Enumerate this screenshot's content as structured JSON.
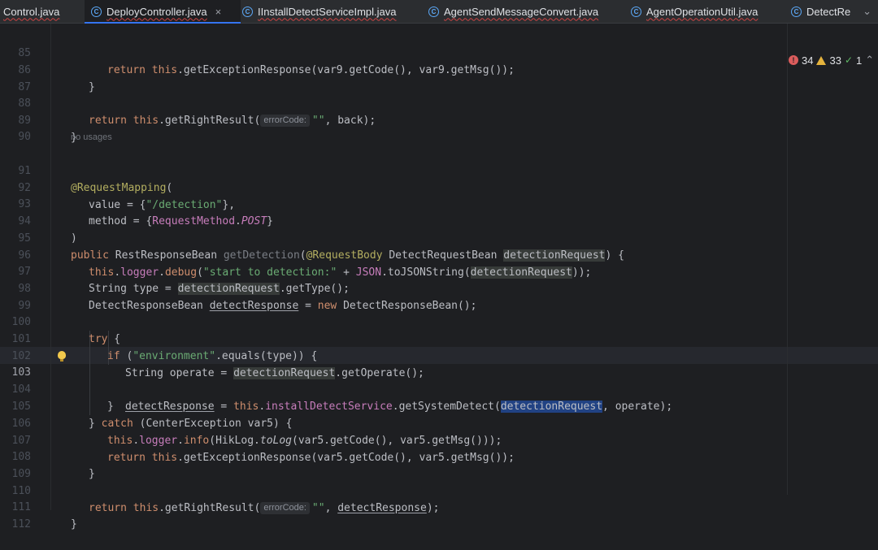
{
  "tabs": [
    {
      "label": "Control.java",
      "icon": "class-icon-clipped",
      "active": false
    },
    {
      "label": "DeployController.java",
      "icon": "class-icon",
      "active": true
    },
    {
      "label": "IInstallDetectServiceImpl.java",
      "icon": "class-icon",
      "active": false
    },
    {
      "label": "AgentSendMessageConvert.java",
      "icon": "class-icon",
      "active": false
    },
    {
      "label": "AgentOperationUtil.java",
      "icon": "class-icon",
      "active": false
    },
    {
      "label": "DetectRe",
      "icon": "class-icon",
      "active": false
    }
  ],
  "tab_close_glyph": "×",
  "tab_more_glyph": "⌄",
  "inspections": {
    "errors": "34",
    "warnings": "33",
    "ok": "1",
    "error_glyph": "!",
    "ok_glyph": "✓",
    "more_glyph": "⌃"
  },
  "no_usages_note": "no usages",
  "hints": {
    "error_code": "errorCode:"
  },
  "code": {
    "l85": {
      "n": "85",
      "t1": "return",
      "t2": " ",
      "t3": "this",
      "t4": ".getExceptionResponse(var9.getCode(), var9.getMsg());"
    },
    "l86": {
      "n": "86",
      "t1": "}"
    },
    "l87": {
      "n": "87"
    },
    "l88": {
      "n": "88",
      "t1": "return",
      "t2": " ",
      "t3": "this",
      "t4": ".getRightResult(",
      "t5": "\"\"",
      "t6": ", back);"
    },
    "l89": {
      "n": "89",
      "t1": "}"
    },
    "l90": {
      "n": "90"
    },
    "l91": {
      "n": "91",
      "t1": "@RequestMapping",
      "t2": "("
    },
    "l92": {
      "n": "92",
      "t1": "value = {",
      "t2": "\"/detection\"",
      "t3": "},"
    },
    "l93": {
      "n": "93",
      "t1": "method = {",
      "t2": "RequestMethod",
      "t3": ".",
      "t4": "POST",
      "t5": "}"
    },
    "l94": {
      "n": "94",
      "t1": ")"
    },
    "l95": {
      "n": "95",
      "t1": "public",
      "t2": " RestResponseBean ",
      "t3": "getDetection",
      "t4": "(",
      "t5": "@RequestBody",
      "t6": " DetectRequestBean ",
      "t7": "detectionRequest",
      "t8": ") {"
    },
    "l96": {
      "n": "96",
      "t1": "this",
      "t2": ".",
      "t3": "logger",
      "t4": ".",
      "t5": "debug",
      "t6": "(",
      "t7": "\"start to detection:\"",
      "t8": " + ",
      "t9": "JSON",
      "t10": ".toJSONString(",
      "t11": "detectionRequest",
      "t12": "));"
    },
    "l97": {
      "n": "97",
      "t1": "String type = ",
      "t2": "detectionRequest",
      "t3": ".getType();"
    },
    "l98": {
      "n": "98",
      "t1": "DetectResponseBean ",
      "t2": "detectResponse",
      "t3": " = ",
      "t4": "new",
      "t5": " DetectResponseBean();"
    },
    "l99": {
      "n": "99"
    },
    "l100": {
      "n": "100",
      "t1": "try",
      "t2": " {"
    },
    "l101": {
      "n": "101",
      "t1": "if",
      "t2": " (",
      "t3": "\"environment\"",
      "t4": ".equals(type)) {"
    },
    "l102": {
      "n": "102",
      "t1": "String operate = ",
      "t2": "detectionRequest",
      "t3": ".getOperate();"
    },
    "l103": {
      "n": "103",
      "t1": "detectResponse",
      "t2": " = ",
      "t3": "this",
      "t4": ".",
      "t5": "installDetectService",
      "t6": ".getSystemDetect(",
      "t7": "detectionRequest",
      "t8": ", operate);"
    },
    "l104": {
      "n": "104",
      "t1": "}"
    },
    "l105": {
      "n": "105",
      "t1": "} ",
      "t2": "catch",
      "t3": " (CenterException var5) {"
    },
    "l106": {
      "n": "106",
      "t1": "this",
      "t2": ".",
      "t3": "logger",
      "t4": ".",
      "t5": "info",
      "t6": "(HikLog.",
      "t7": "toLog",
      "t8": "(var5.getCode(), var5.getMsg()));"
    },
    "l107": {
      "n": "107",
      "t1": "return",
      "t2": " ",
      "t3": "this",
      "t4": ".getExceptionResponse(var5.getCode(), var5.getMsg());"
    },
    "l108": {
      "n": "108",
      "t1": "}"
    },
    "l109": {
      "n": "109"
    },
    "l110": {
      "n": "110",
      "t1": "return",
      "t2": " ",
      "t3": "this",
      "t4": ".getRightResult(",
      "t5": "\"\"",
      "t6": ", ",
      "t7": "detectResponse",
      "t8": ");"
    },
    "l111": {
      "n": "111",
      "t1": "}"
    },
    "l112": {
      "n": "112"
    }
  }
}
